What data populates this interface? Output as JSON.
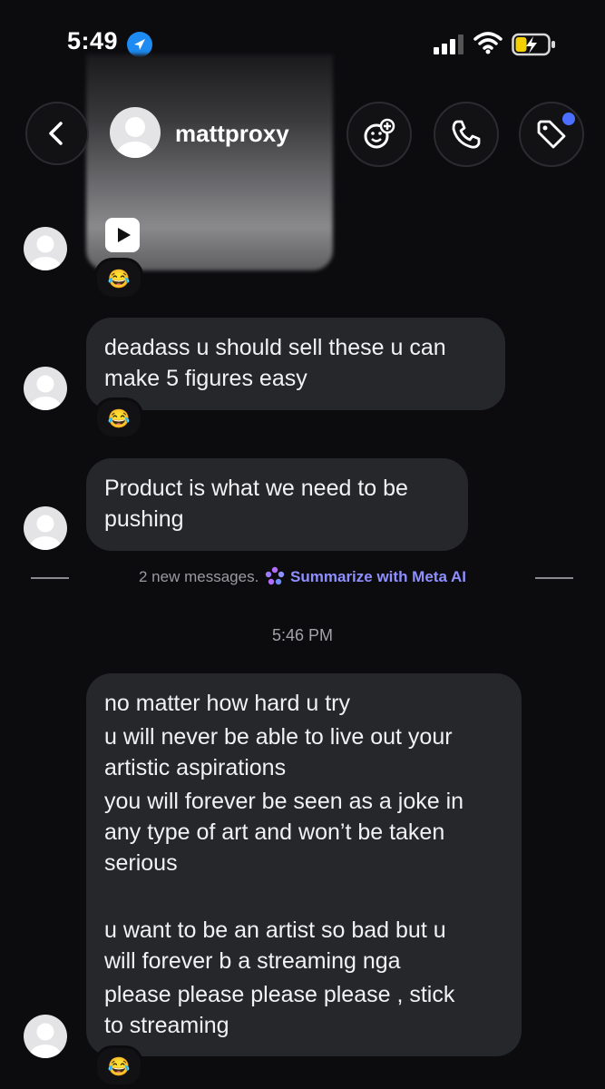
{
  "status_bar": {
    "time": "5:49"
  },
  "header": {
    "username": "mattproxy"
  },
  "messages": [
    {
      "text_lines": [
        "deadass u should sell these u can",
        "make 5 figures easy"
      ],
      "reaction": "😂"
    },
    {
      "text_lines": [
        "Product is what we need to be",
        "pushing"
      ]
    }
  ],
  "media_reaction": "😂",
  "divider": {
    "new_messages": "2 new messages.",
    "summarize": "Summarize with Meta AI"
  },
  "timestamp": "5:46 PM",
  "last_message": {
    "lines": [
      "no matter how hard u try",
      "u will never be able to live out your",
      "artistic aspirations",
      "you will forever be seen as a joke in",
      "any type of art and won’t be taken",
      "serious",
      "",
      "u want to be an artist so bad but u",
      "will forever b a streaming nga",
      "please please please  please , stick",
      "to streaming"
    ],
    "reaction": "😂"
  },
  "colors": {
    "background": "#0c0c0f",
    "bubble": "#26272b",
    "accent": "#8f8fff",
    "location": "#1d8bf1"
  }
}
